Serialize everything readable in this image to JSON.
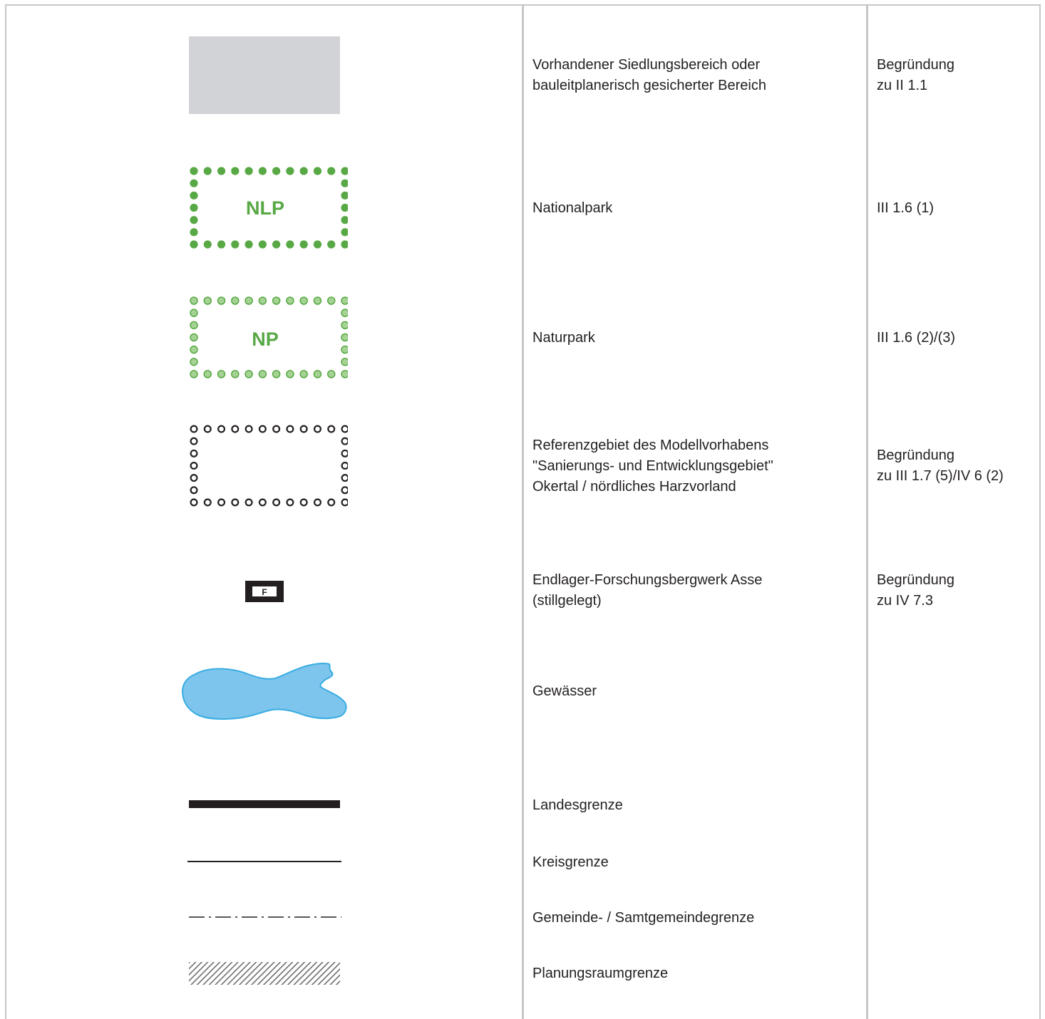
{
  "legend": {
    "rows": [
      {
        "symbol": "grey-fill-area",
        "description": [
          "Vorhandener Siedlungsbereich oder",
          "bauleitplanerisch gesicherter Bereich"
        ],
        "reference": [
          "Begründung",
          "zu II 1.1"
        ]
      },
      {
        "symbol": "green-dotted-border",
        "symbol_label": "NLP",
        "description": [
          "Nationalpark"
        ],
        "reference": [
          "III 1.6 (1)"
        ]
      },
      {
        "symbol": "light-green-dotted-border",
        "symbol_label": "NP",
        "description": [
          "Naturpark"
        ],
        "reference": [
          "III 1.6 (2)/(3)"
        ]
      },
      {
        "symbol": "black-ring-dotted-border",
        "description": [
          "Referenzgebiet des Modellvorhabens",
          "\"Sanierungs- und Entwicklungsgebiet\"",
          "Okertal / nördliches Harzvorland"
        ],
        "reference": [
          "Begründung",
          "zu III 1.7 (5)/IV 6 (2)"
        ]
      },
      {
        "symbol": "boxed-letter-marker",
        "symbol_label": "F",
        "description": [
          "Endlager-Forschungsbergwerk Asse",
          "(stillgelegt)"
        ],
        "reference": [
          "Begründung",
          "zu IV 7.3"
        ]
      },
      {
        "symbol": "water-body-shape",
        "description": [
          "Gewässer"
        ],
        "reference": []
      },
      {
        "symbol": "thick-solid-line",
        "description": [
          "Landesgrenze"
        ],
        "reference": []
      },
      {
        "symbol": "thin-solid-line",
        "description": [
          "Kreisgrenze"
        ],
        "reference": []
      },
      {
        "symbol": "dash-dot-line",
        "description": [
          "Gemeinde- / Samtgemeindegrenze"
        ],
        "reference": []
      },
      {
        "symbol": "hatched-band",
        "description": [
          "Planungsraumgrenze"
        ],
        "reference": []
      }
    ]
  },
  "colors": {
    "frame": "#c6c7ca",
    "settlement_fill": "#d1d3d6",
    "national_park_green": "#58a845",
    "nature_park_dot_fill": "#a5d394",
    "nature_park_dot_stroke": "#58a845",
    "ring_dots": "#231f20",
    "water_fill": "#7dc5ec",
    "water_stroke": "#39ace2",
    "line_black": "#231f20"
  }
}
